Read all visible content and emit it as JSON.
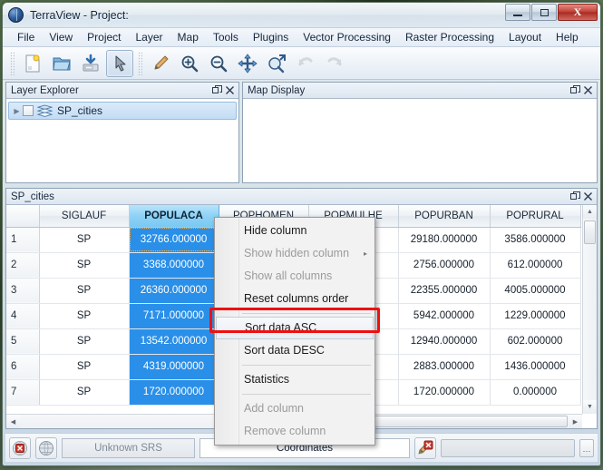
{
  "window": {
    "title": "TerraView - Project:",
    "app_icon": "globe-icon",
    "minimize_label": "Minimize",
    "maximize_label": "Maximize",
    "close_label": "X"
  },
  "menubar": {
    "items": [
      {
        "label": "File"
      },
      {
        "label": "View"
      },
      {
        "label": "Project"
      },
      {
        "label": "Layer"
      },
      {
        "label": "Map"
      },
      {
        "label": "Tools"
      },
      {
        "label": "Plugins"
      },
      {
        "label": "Vector Processing"
      },
      {
        "label": "Raster Processing"
      },
      {
        "label": "Layout"
      },
      {
        "label": "Help"
      }
    ]
  },
  "toolbar": {
    "buttons": [
      {
        "icon": "new-project-icon",
        "state": "normal"
      },
      {
        "icon": "open-folder-icon",
        "state": "normal"
      },
      {
        "icon": "save-project-icon",
        "state": "normal"
      },
      {
        "icon": "pointer-arrow-icon",
        "state": "active"
      },
      {
        "icon": "pencil-draw-icon",
        "state": "normal"
      },
      {
        "icon": "zoom-in-icon",
        "state": "normal"
      },
      {
        "icon": "zoom-out-icon",
        "state": "normal"
      },
      {
        "icon": "pan-icon",
        "state": "normal"
      },
      {
        "icon": "zoom-extent-icon",
        "state": "normal"
      },
      {
        "icon": "undo-icon",
        "state": "disabled"
      },
      {
        "icon": "redo-icon",
        "state": "disabled"
      }
    ]
  },
  "layer_explorer": {
    "title": "Layer Explorer",
    "float_icon": "float-icon",
    "close_icon": "close-icon",
    "tree": [
      {
        "label": "SP_cities",
        "icon": "layers-icon",
        "checked": false,
        "expand_arrow": "▶",
        "selected": true
      }
    ]
  },
  "map_display": {
    "title": "Map Display",
    "float_icon": "float-icon",
    "close_icon": "close-icon"
  },
  "attribute_table": {
    "title": "SP_cities",
    "float_icon": "float-icon",
    "close_icon": "close-icon",
    "columns": [
      "",
      "SIGLAUF",
      "POPULACA",
      "POPHOMEN",
      "POPMULHE",
      "POPURBAN",
      "POPRURAL"
    ],
    "selected_column": "POPULACA",
    "rows": [
      {
        "num": "1",
        "SIGLAUF": "SP",
        "POPULACA": "32766.000000",
        "POPHOMEN": "",
        "POPMULHE": "",
        "POPURBAN": "29180.000000",
        "POPRURAL": "3586.000000"
      },
      {
        "num": "2",
        "SIGLAUF": "SP",
        "POPULACA": "3368.000000",
        "POPHOMEN": "",
        "POPMULHE": "",
        "POPURBAN": "2756.000000",
        "POPRURAL": "612.000000"
      },
      {
        "num": "3",
        "SIGLAUF": "SP",
        "POPULACA": "26360.000000",
        "POPHOMEN": "",
        "POPMULHE": "",
        "POPURBAN": "22355.000000",
        "POPRURAL": "4005.000000"
      },
      {
        "num": "4",
        "SIGLAUF": "SP",
        "POPULACA": "7171.000000",
        "POPHOMEN": "",
        "POPMULHE": "",
        "POPURBAN": "5942.000000",
        "POPRURAL": "1229.000000"
      },
      {
        "num": "5",
        "SIGLAUF": "SP",
        "POPULACA": "13542.000000",
        "POPHOMEN": "",
        "POPMULHE": "",
        "POPURBAN": "12940.000000",
        "POPRURAL": "602.000000"
      },
      {
        "num": "6",
        "SIGLAUF": "SP",
        "POPULACA": "4319.000000",
        "POPHOMEN": "",
        "POPMULHE": "",
        "POPURBAN": "2883.000000",
        "POPRURAL": "1436.000000"
      },
      {
        "num": "7",
        "SIGLAUF": "SP",
        "POPULACA": "1720.000000",
        "POPHOMEN": "",
        "POPMULHE": "",
        "POPURBAN": "1720.000000",
        "POPRURAL": "0.000000"
      }
    ]
  },
  "context_menu": {
    "items": [
      {
        "label": "Hide column",
        "disabled": false,
        "submenu": false,
        "highlighted": false
      },
      {
        "label": "Show hidden column",
        "disabled": true,
        "submenu": true,
        "highlighted": false
      },
      {
        "label": "Show all columns",
        "disabled": true,
        "submenu": false,
        "highlighted": false
      },
      {
        "label": "Reset columns order",
        "disabled": false,
        "submenu": false,
        "highlighted": false
      },
      {
        "label": "Sort data ASC",
        "disabled": false,
        "submenu": false,
        "highlighted": true
      },
      {
        "label": "Sort data DESC",
        "disabled": false,
        "submenu": false,
        "highlighted": false
      },
      {
        "label": "Statistics",
        "disabled": false,
        "submenu": false,
        "highlighted": false
      },
      {
        "label": "Add column",
        "disabled": true,
        "submenu": false,
        "highlighted": false
      },
      {
        "label": "Remove column",
        "disabled": true,
        "submenu": false,
        "highlighted": false
      }
    ],
    "submenu_arrow": "▸"
  },
  "statusbar": {
    "stop_icon": "globe-stop-icon",
    "globe_icon": "globe-icon",
    "srs_label": "Unknown SRS",
    "coordinates_label": "Coordinates",
    "draw_stop_icon": "pencil-stop-icon",
    "dots_label": "⋯"
  },
  "colors": {
    "selection_cell": "#2a8fe8",
    "selection_header": "#8ed2f5",
    "annotation_box": "#f01010",
    "close_button": "#c4453c"
  }
}
